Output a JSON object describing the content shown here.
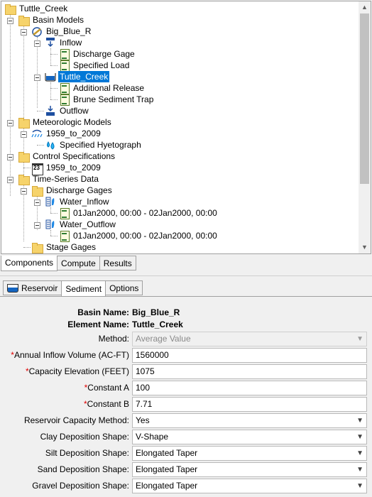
{
  "tree": {
    "items": [
      {
        "label": "Tuttle_Creek",
        "icon": "folder-icon"
      },
      {
        "label": "Basin Models",
        "icon": "folder-icon"
      },
      {
        "label": "Big_Blue_R",
        "icon": "basin-model-icon"
      },
      {
        "label": "Inflow",
        "icon": "inflow-icon"
      },
      {
        "label": "Discharge Gage",
        "icon": "gage-doc-icon"
      },
      {
        "label": "Specified Load",
        "icon": "gage-doc-icon"
      },
      {
        "label": "Tuttle_Creek",
        "icon": "reservoir-icon",
        "selected": true
      },
      {
        "label": "Additional Release",
        "icon": "gage-doc-icon"
      },
      {
        "label": "Brune Sediment Trap",
        "icon": "gage-doc-icon"
      },
      {
        "label": "Outflow",
        "icon": "outflow-icon"
      },
      {
        "label": "Meteorologic Models",
        "icon": "folder-icon"
      },
      {
        "label": "1959_to_2009",
        "icon": "met-model-icon"
      },
      {
        "label": "Specified Hyetograph",
        "icon": "precip-icon"
      },
      {
        "label": "Control Specifications",
        "icon": "folder-icon"
      },
      {
        "label": "1959_to_2009",
        "icon": "calendar-icon"
      },
      {
        "label": "Time-Series Data",
        "icon": "folder-icon"
      },
      {
        "label": "Discharge Gages",
        "icon": "folder-icon"
      },
      {
        "label": "Water_Inflow",
        "icon": "gage-icon"
      },
      {
        "label": "01Jan2000, 00:00 - 02Jan2000, 00:00",
        "icon": "gage-doc-icon"
      },
      {
        "label": "Water_Outflow",
        "icon": "gage-icon"
      },
      {
        "label": "01Jan2000, 00:00 - 02Jan2000, 00:00",
        "icon": "gage-doc-icon"
      },
      {
        "label": "Stage Gages",
        "icon": "folder-icon"
      }
    ]
  },
  "bottom_tabs": [
    "Components",
    "Compute",
    "Results"
  ],
  "editor_tabs": [
    "Reservoir",
    "Sediment",
    "Options"
  ],
  "form": {
    "basin_name_label": "Basin Name:",
    "basin_name_value": "Big_Blue_R",
    "element_name_label": "Element Name:",
    "element_name_value": "Tuttle_Creek",
    "method_label": "Method:",
    "method_value": "Average Value",
    "annual_inflow_label": "Annual Inflow Volume (AC-FT)",
    "annual_inflow_value": "1560000",
    "capacity_elev_label": "Capacity Elevation (FEET)",
    "capacity_elev_value": "1075",
    "constant_a_label": "Constant A",
    "constant_a_value": "100",
    "constant_b_label": "Constant B",
    "constant_b_value": "7.71",
    "res_cap_method_label": "Reservoir Capacity Method:",
    "res_cap_method_value": "Yes",
    "clay_label": "Clay Deposition Shape:",
    "clay_value": "V-Shape",
    "silt_label": "Silt Deposition Shape:",
    "silt_value": "Elongated Taper",
    "sand_label": "Sand Deposition Shape:",
    "sand_value": "Elongated Taper",
    "gravel_label": "Gravel Deposition Shape:",
    "gravel_value": "Elongated Taper",
    "required_marker": "*"
  },
  "colors": {
    "selection": "#0078d7",
    "required": "#e00000",
    "folder": "#f6d36b"
  }
}
